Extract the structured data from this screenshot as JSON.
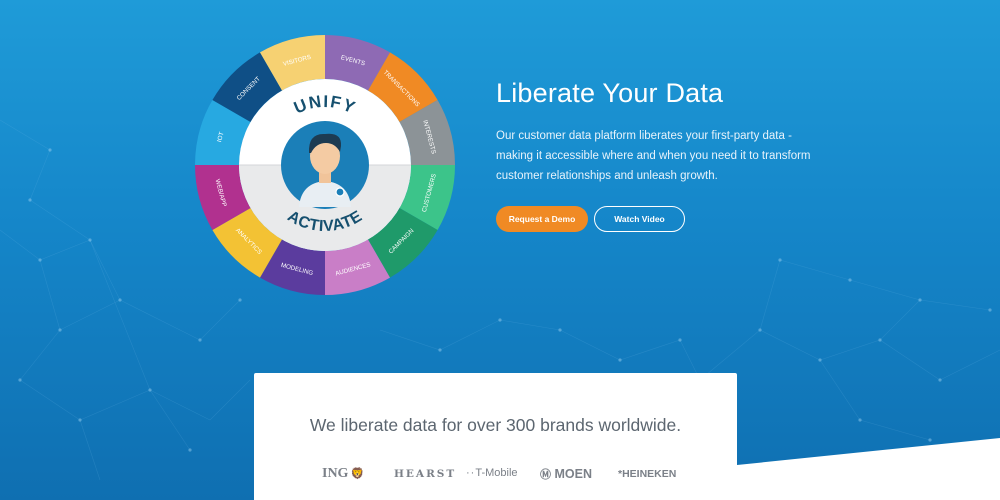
{
  "wheel": {
    "top_label": "UNIFY",
    "bottom_label": "ACTIVATE",
    "segments": [
      {
        "label": "EVENTS",
        "color": "#8e6ab4"
      },
      {
        "label": "TRANSACTIONS",
        "color": "#f08a24"
      },
      {
        "label": "INTERESTS",
        "color": "#8c9397"
      },
      {
        "label": "CUSTOMERS",
        "color": "#3cc48a"
      },
      {
        "label": "CAMPAIGN",
        "color": "#1f9a6a"
      },
      {
        "label": "AUDIENCES",
        "color": "#c97ec7"
      },
      {
        "label": "MODELING",
        "color": "#5b3c9e"
      },
      {
        "label": "ANALYTICS",
        "color": "#f3c234"
      },
      {
        "label": "WEB/APP",
        "color": "#b1318f"
      },
      {
        "label": "IOT",
        "color": "#27a9e1"
      },
      {
        "label": "CONSENT",
        "color": "#0f4f86"
      },
      {
        "label": "VISITORS",
        "color": "#f6d172"
      }
    ]
  },
  "hero": {
    "title": "Liberate Your Data",
    "description": "Our customer data platform liberates your first-party data - making it accessible where and when you need it to transform customer relationships and unleash growth.",
    "primary_button": "Request a Demo",
    "secondary_button": "Watch Video",
    "accent_color": "#f08a24"
  },
  "brands": {
    "heading": "We liberate data for over 300 brands worldwide.",
    "logos": {
      "ing": "ING",
      "hearst": "HEARST",
      "tmobile": "T-Mobile",
      "moen": "MOEN",
      "heineken": "HEINEKEN"
    }
  }
}
